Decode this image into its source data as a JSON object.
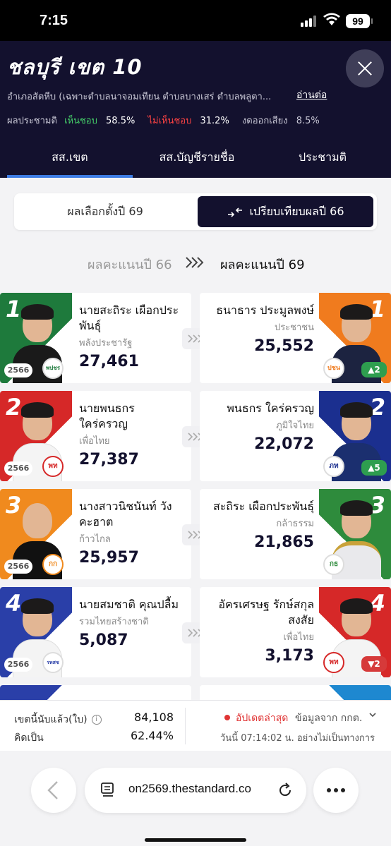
{
  "status": {
    "time": "7:15",
    "battery": "99"
  },
  "header": {
    "title": "ชลบุรี เขต 10",
    "district": "อำเภอสัตหีบ (เฉพาะตำบลนาจอมเทียน ตำบลบางเสร่ ตำบลพลูตา...",
    "read_more": "อ่านต่อ",
    "referendum_label": "ผลประชามติ",
    "agree_label": "เห็นชอบ",
    "agree_pct": "58.5%",
    "disagree_label": "ไม่เห็นชอบ",
    "disagree_pct": "31.2%",
    "abstain_label": "งดออกเสียง",
    "abstain_pct": "8.5%"
  },
  "tabs": [
    {
      "label": "สส.เขต",
      "active": true
    },
    {
      "label": "สส.บัญชีรายชื่อ",
      "active": false
    },
    {
      "label": "ประชามติ",
      "active": false
    }
  ],
  "toggle": {
    "option1": "ผลเลือกตั้งปี 69",
    "option2": "เปรียบเทียบผลปี 66"
  },
  "compare_header": {
    "left": "ผลคะแนนปี 66",
    "right": "ผลคะแนนปี 69"
  },
  "rows": [
    {
      "rank": "1",
      "left": {
        "name": "นายสะถิระ เผือกประพันธุ์",
        "party": "พลังประชารัฐ",
        "votes": "27,461",
        "year": "2566",
        "color": "#1e7a3c",
        "logo": "พปชร"
      },
      "right": {
        "name": "ธนาธาร ประมูลพงษ์",
        "party": "ประชาชน",
        "votes": "25,552",
        "color": "#f07b1e",
        "logo": "ปชน",
        "change": "▲2",
        "change_dir": "up"
      }
    },
    {
      "rank": "2",
      "left": {
        "name": "นายพนธกร ใคร่ครวญ",
        "party": "เพื่อไทย",
        "votes": "27,387",
        "year": "2566",
        "color": "#d62828",
        "logo": "พท"
      },
      "right": {
        "name": "พนธกร ใคร่ครวญ",
        "party": "ภูมิใจไทย",
        "votes": "22,072",
        "color": "#1b2f8f",
        "logo": "ภท",
        "change": "▲5",
        "change_dir": "up"
      }
    },
    {
      "rank": "3",
      "left": {
        "name": "นางสาวนิชนันท์ วังคะฮาต",
        "party": "ก้าวไกล",
        "votes": "25,957",
        "year": "2566",
        "color": "#f08a1e",
        "logo": "กก"
      },
      "right": {
        "name": "สะถิระ เผือกประพันธุ์",
        "party": "กล้าธรรม",
        "votes": "21,865",
        "color": "#2e8b3c",
        "logo": "กธ",
        "change": "",
        "change_dir": ""
      }
    },
    {
      "rank": "4",
      "left": {
        "name": "นายสมชาติ คุณปลื้ม",
        "party": "รวมไทยสร้างชาติ",
        "votes": "5,087",
        "year": "2566",
        "color": "#2a3fa8",
        "logo": "รทสช"
      },
      "right": {
        "name": "อัครเศรษฐ รักษ์สกุลสงสัย",
        "party": "เพื่อไทย",
        "votes": "3,173",
        "color": "#d62828",
        "logo": "พท",
        "change": "▼2",
        "change_dir": "down"
      }
    }
  ],
  "summary": {
    "counted_label": "เขตนี้นับแล้ว(ใบ)",
    "counted_value": "84,108",
    "percent_label": "คิดเป็น",
    "percent_value": "62.44%",
    "update_label": "อัปเดตล่าสุด",
    "source": "ข้อมูลจาก กกต.",
    "timestamp": "วันนี้ 07:14:02 น. อย่างไม่เป็นทางการ"
  },
  "browser": {
    "url": "on2569.thestandard.co"
  }
}
